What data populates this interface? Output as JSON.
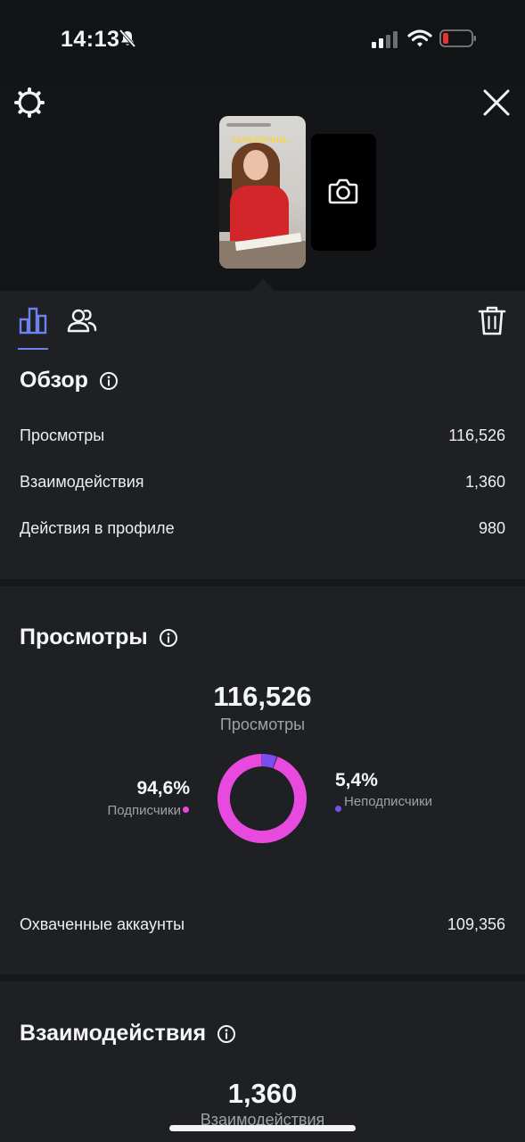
{
  "status_bar": {
    "time": "14:13"
  },
  "thumbnail": {
    "caption": "ТАРЕЛОЧНИ..."
  },
  "overview": {
    "title": "Обзор",
    "rows": [
      {
        "label": "Просмотры",
        "value": "116,526"
      },
      {
        "label": "Взаимодействия",
        "value": "1,360"
      },
      {
        "label": "Действия в профиле",
        "value": "980"
      }
    ]
  },
  "views": {
    "title": "Просмотры",
    "total": "116,526",
    "total_label": "Просмотры",
    "followers_pct": "94,6%",
    "followers_label": "Подписчики",
    "nonfollowers_pct": "5,4%",
    "nonfollowers_label": "Неподписчики",
    "followers_fraction": 0.946,
    "reached_label": "Охваченные аккаунты",
    "reached_value": "109,356"
  },
  "interactions": {
    "title": "Взаимодействия",
    "total": "1,360",
    "total_label": "Взаимодействия"
  },
  "colors": {
    "followers": "#e84ae0",
    "nonfollowers": "#7a4df0",
    "tab_active": "#6a83ee"
  },
  "icons": {
    "settings": "gear-icon",
    "close": "close-icon",
    "add_story": "camera-icon",
    "insights_tab": "bar-chart-icon",
    "audience_tab": "people-icon",
    "delete": "trash-icon",
    "info": "info-icon"
  }
}
